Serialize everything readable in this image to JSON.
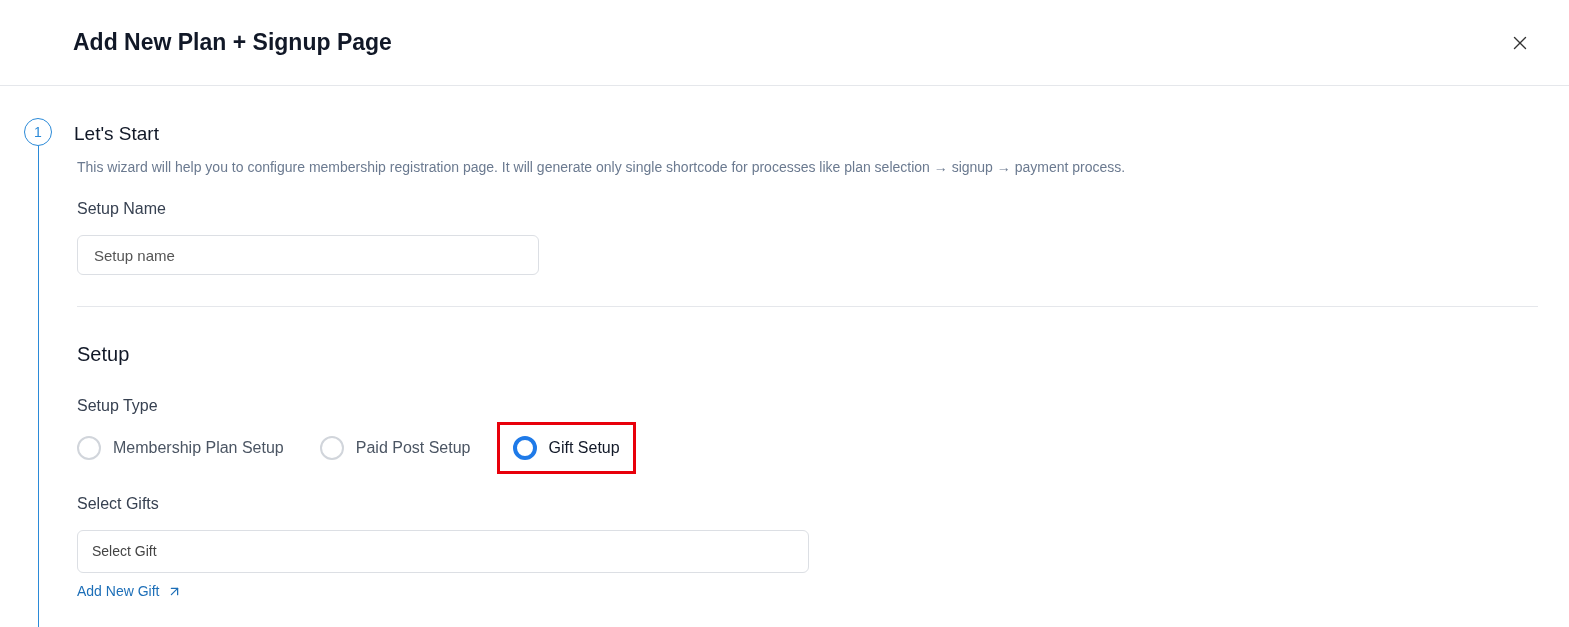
{
  "dialog": {
    "title": "Add New Plan + Signup Page"
  },
  "step": {
    "number": "1",
    "title": "Let's Start",
    "description": "This wizard will help you to configure membership registration page. It will generate only single shortcode for processes like plan selection → signup → payment process."
  },
  "setup_name": {
    "label": "Setup Name",
    "placeholder": "Setup name"
  },
  "setup": {
    "title": "Setup",
    "type_label": "Setup Type",
    "options": [
      {
        "label": "Membership Plan Setup",
        "selected": false,
        "highlighted": false
      },
      {
        "label": "Paid Post Setup",
        "selected": false,
        "highlighted": false
      },
      {
        "label": "Gift Setup",
        "selected": true,
        "highlighted": true
      }
    ]
  },
  "gifts": {
    "label": "Select Gifts",
    "placeholder": "Select Gift",
    "link": "Add New Gift"
  }
}
